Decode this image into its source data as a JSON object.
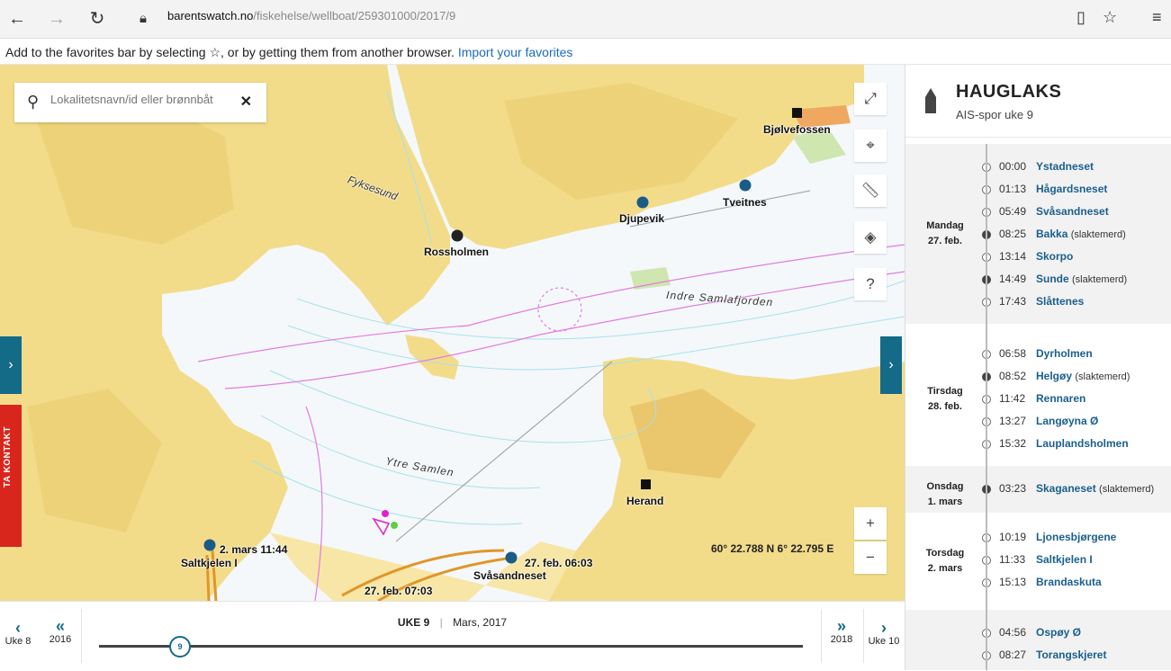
{
  "browser": {
    "url_host": "barentswatch.no",
    "url_path": "/fiskehelse/wellboat/259301000/2017/9",
    "favorites_text": "Add to the favorites bar by selecting ☆, or by getting them from another browser.",
    "favorites_link": "Import your favorites"
  },
  "search": {
    "placeholder": "Lokalitetsnavn/id eller brønnbåt"
  },
  "map": {
    "coords": "60° 22.788 N 6° 22.795 E",
    "side_tab": "TA KONTAKT",
    "places": {
      "bjolvefossen": "Bjølvefossen",
      "djupevik": "Djupevik",
      "tveitnes": "Tveitnes",
      "rossholmen": "Rossholmen",
      "herand": "Herand",
      "saltkjelen": "Saltkjelen I",
      "saltkjelen_time": "2. mars 11:44",
      "svasandneset": "Svåsandneset",
      "svasandneset_time": "27. feb. 06:03",
      "track_time": "27. feb. 07:03",
      "fjord1": "Indre Samlafjorden",
      "fjord2": "Ytre Samlen",
      "fyksesund": "Fyksesund"
    },
    "zoom_in": "+",
    "zoom_out": "−"
  },
  "timeline": {
    "week_label": "UKE 9",
    "month_label": "Mars, 2017",
    "prev_week": "Uke 8",
    "prev_year": "2016",
    "next_year": "2018",
    "next_week": "Uke 10",
    "current_week": "9"
  },
  "panel": {
    "vessel": "HAUGLAKS",
    "subtitle": "AIS-spor uke 9",
    "days": [
      {
        "day": "Mandag",
        "date": "27. feb.",
        "stops": [
          {
            "time": "00:00",
            "name": "Ystadneset",
            "note": ""
          },
          {
            "time": "01:13",
            "name": "Hågardsneset",
            "note": ""
          },
          {
            "time": "05:49",
            "name": "Svåsandneset",
            "note": ""
          },
          {
            "time": "08:25",
            "name": "Bakka",
            "note": "(slaktemerd)"
          },
          {
            "time": "13:14",
            "name": "Skorpo",
            "note": ""
          },
          {
            "time": "14:49",
            "name": "Sunde",
            "note": "(slaktemerd)"
          },
          {
            "time": "17:43",
            "name": "Slåttenes",
            "note": ""
          }
        ]
      },
      {
        "day": "Tirsdag",
        "date": "28. feb.",
        "stops": [
          {
            "time": "06:58",
            "name": "Dyrholmen",
            "note": ""
          },
          {
            "time": "08:52",
            "name": "Helgøy",
            "note": "(slaktemerd)"
          },
          {
            "time": "11:42",
            "name": "Rennaren",
            "note": ""
          },
          {
            "time": "13:27",
            "name": "Langøyna Ø",
            "note": ""
          },
          {
            "time": "15:32",
            "name": "Lauplandsholmen",
            "note": ""
          }
        ]
      },
      {
        "day": "Onsdag",
        "date": "1. mars",
        "stops": [
          {
            "time": "03:23",
            "name": "Skaganeset",
            "note": "(slaktemerd)"
          }
        ]
      },
      {
        "day": "Torsdag",
        "date": "2. mars",
        "stops": [
          {
            "time": "10:19",
            "name": "Ljonesbjørgene",
            "note": ""
          },
          {
            "time": "11:33",
            "name": "Saltkjelen I",
            "note": ""
          },
          {
            "time": "15:13",
            "name": "Brandaskuta",
            "note": ""
          }
        ]
      },
      {
        "day": "",
        "date": "",
        "stops": [
          {
            "time": "04:56",
            "name": "Ospøy Ø",
            "note": ""
          },
          {
            "time": "08:27",
            "name": "Torangskjeret",
            "note": ""
          }
        ]
      }
    ]
  },
  "colors": {
    "accent": "#146b88",
    "land": "#f2dc8a",
    "water": "#f4f8fb",
    "track": "#e0962a",
    "contact": "#d9261c"
  }
}
